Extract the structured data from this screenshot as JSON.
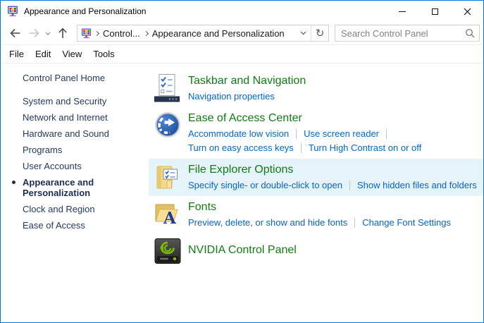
{
  "window": {
    "title": "Appearance and Personalization"
  },
  "toolbar": {
    "breadcrumb": [
      "Control...",
      "Appearance and Personalization"
    ],
    "search_placeholder": "Search Control Panel"
  },
  "icons": {
    "refresh": "↻",
    "fonts_letter": "A"
  },
  "menubar": {
    "items": [
      "File",
      "Edit",
      "View",
      "Tools"
    ]
  },
  "sidebar": {
    "home": "Control Panel Home",
    "top_items": [
      "System and Security",
      "Network and Internet",
      "Hardware and Sound",
      "Programs",
      "User Accounts"
    ],
    "selected": "Appearance and Personalization",
    "bottom_items": [
      "Clock and Region",
      "Ease of Access"
    ]
  },
  "main": {
    "sections": [
      {
        "title": "Taskbar and Navigation",
        "links": [
          [
            "Navigation properties"
          ]
        ]
      },
      {
        "title": "Ease of Access Center",
        "links": [
          [
            "Accommodate low vision",
            "Use screen reader"
          ],
          [
            "Turn on easy access keys",
            "Turn High Contrast on or off"
          ]
        ]
      },
      {
        "title": "File Explorer Options",
        "links": [
          [
            "Specify single- or double-click to open",
            "Show hidden files and folders"
          ]
        ]
      },
      {
        "title": "Fonts",
        "links": [
          [
            "Preview, delete, or show and hide fonts",
            "Change Font Settings"
          ]
        ]
      },
      {
        "title": "NVIDIA Control Panel",
        "links": []
      }
    ]
  },
  "colors": {
    "accent": "#0078d7",
    "heading_green": "#107c10",
    "link_blue": "#0066cc",
    "highlight_row": "#e5f3fb",
    "sidebar_text": "#243a5e"
  }
}
